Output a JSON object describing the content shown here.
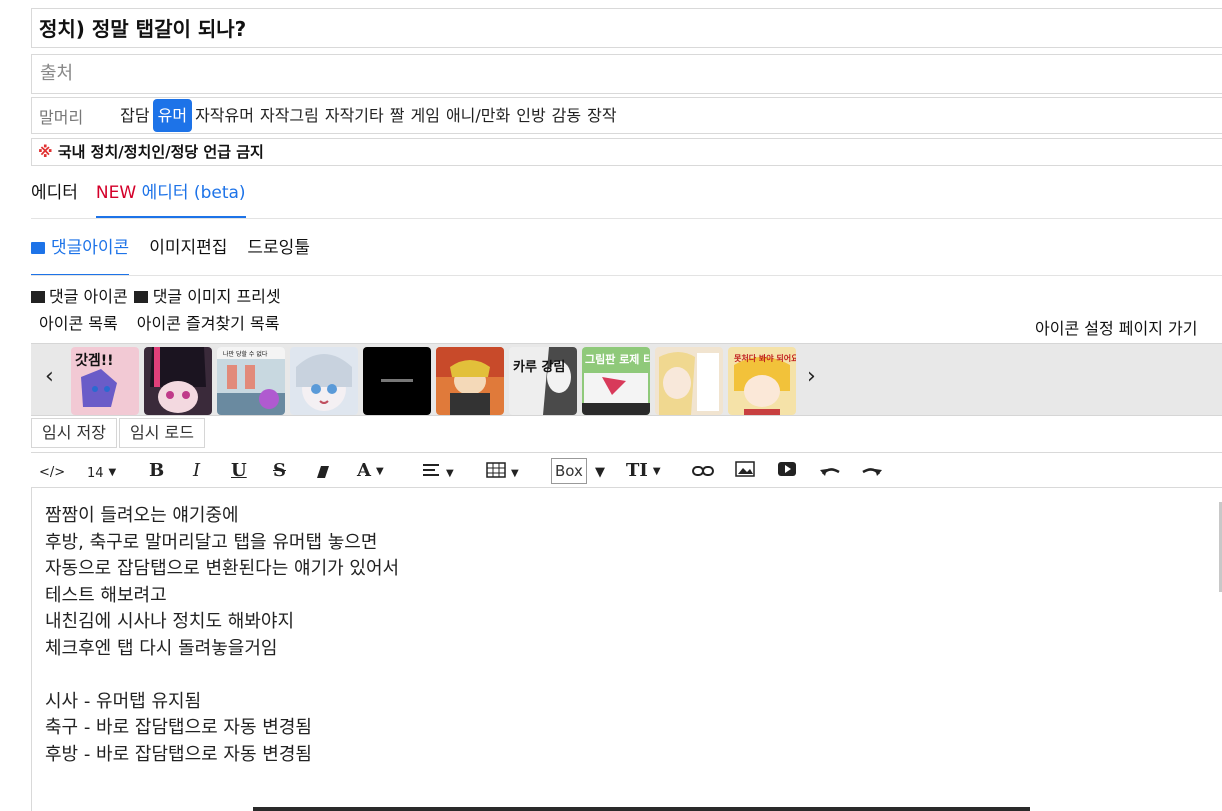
{
  "post": {
    "title": "정치) 정말 탭갈이 되나?",
    "source_placeholder": "출처"
  },
  "categories": {
    "label": "말머리",
    "items": [
      "잡담",
      "유머",
      "자작유머",
      "자작그림",
      "자작기타",
      "짤",
      "게임",
      "애니/만화",
      "인방",
      "감동",
      "장작"
    ],
    "active": "유머"
  },
  "notice": {
    "mark": "※",
    "text": "국내 정치/정치인/정당 언급 금지"
  },
  "editor_tabs": {
    "editor": "에디터",
    "new_label": "NEW",
    "new_editor": "에디터 (beta)"
  },
  "tool_tabs": {
    "comment_icon": "댓글아이콘",
    "image_edit": "이미지편집",
    "drawing": "드로잉툴"
  },
  "icon_panel": {
    "comment_icon_tab": "댓글 아이콘",
    "image_preset_tab": "댓글 이미지 프리셋",
    "icon_list": "아이콘 목록",
    "favorites_list": "아이콘 즐겨찾기 목록",
    "settings_link": "아이콘 설정 페이지 가기",
    "prev_arrow": "‹",
    "next_arrow": "›",
    "thumbnails": [
      {
        "text": "갓겜!!",
        "color": "#f2c9d4"
      },
      {
        "text": "",
        "color": "#3a2a3a"
      },
      {
        "text": "나만 당할 수 없다",
        "color": "#c8d8e0"
      },
      {
        "text": "",
        "color": "#dfe6ef"
      },
      {
        "text": "",
        "color": "#000000"
      },
      {
        "text": "",
        "color": "#e07a3a"
      },
      {
        "text": "카루 강림",
        "color": "#eeeeee"
      },
      {
        "text": "그림판 로제 타콘",
        "color": "#8fc97a"
      },
      {
        "text": "",
        "color": "#f1e4d0"
      },
      {
        "text": "못처다 봐야 되어요!",
        "color": "#f5e2a8"
      }
    ]
  },
  "temp": {
    "save": "임시 저장",
    "load": "임시 로드"
  },
  "toolbar": {
    "code": "</>",
    "font_size": "14",
    "bold": "B",
    "italic": "I",
    "underline": "U",
    "strike": "S",
    "font_color": "A",
    "box": "Box",
    "text_size": "TI"
  },
  "content": {
    "lines": [
      "짬짬이 들려오는 얘기중에",
      "후방, 축구로 말머리달고 탭을 유머탭 놓으면",
      "자동으로 잡담탭으로 변환된다는 얘기가 있어서",
      "테스트 해보려고",
      "내친김에 시사나 정치도 해봐야지",
      "체크후엔 탭 다시 돌려놓을거임",
      "",
      "시사 - 유머탭 유지됨",
      "축구 - 바로 잡담탭으로 자동 변경됨",
      "후방 - 바로 잡담탭으로 자동 변경됨"
    ]
  }
}
